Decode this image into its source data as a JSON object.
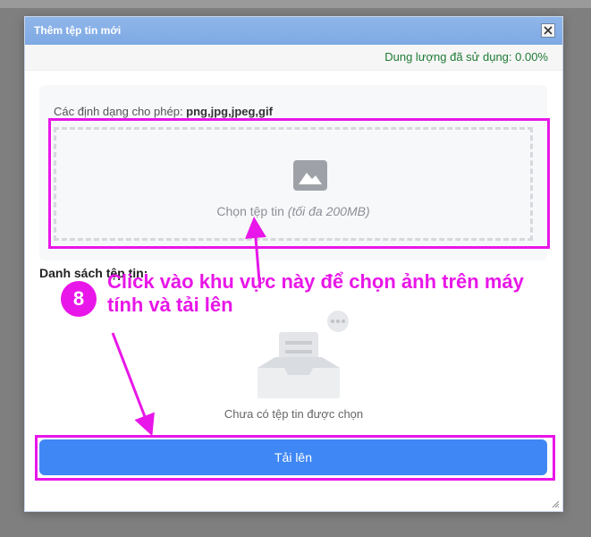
{
  "dialog": {
    "title": "Thêm tệp tin mới",
    "usage_text": "Dung lượng đã sử dụng: 0.00%",
    "formats_label": "Các định dạng cho phép: ",
    "formats_value": "png,jpg,jpeg,gif",
    "dropzone_label": "Chọn tệp tin ",
    "dropzone_hint": "(tối đa 200MB)",
    "file_list_title": "Danh sách tệp tin:",
    "empty_text": "Chưa có tệp tin được chọn",
    "upload_button": "Tải lên"
  },
  "annotation": {
    "step_number": "8",
    "callout_text": "Click vào khu vực này để chọn ảnh trên máy tính và tải lên"
  },
  "colors": {
    "accent": "#3f87f5",
    "highlight": "#e816e8",
    "usage_text": "#1f7a35",
    "titlebar": "#8fb6ea"
  },
  "icons": [
    "close-icon",
    "image-icon",
    "empty-inbox-icon",
    "resize-grip-icon"
  ]
}
